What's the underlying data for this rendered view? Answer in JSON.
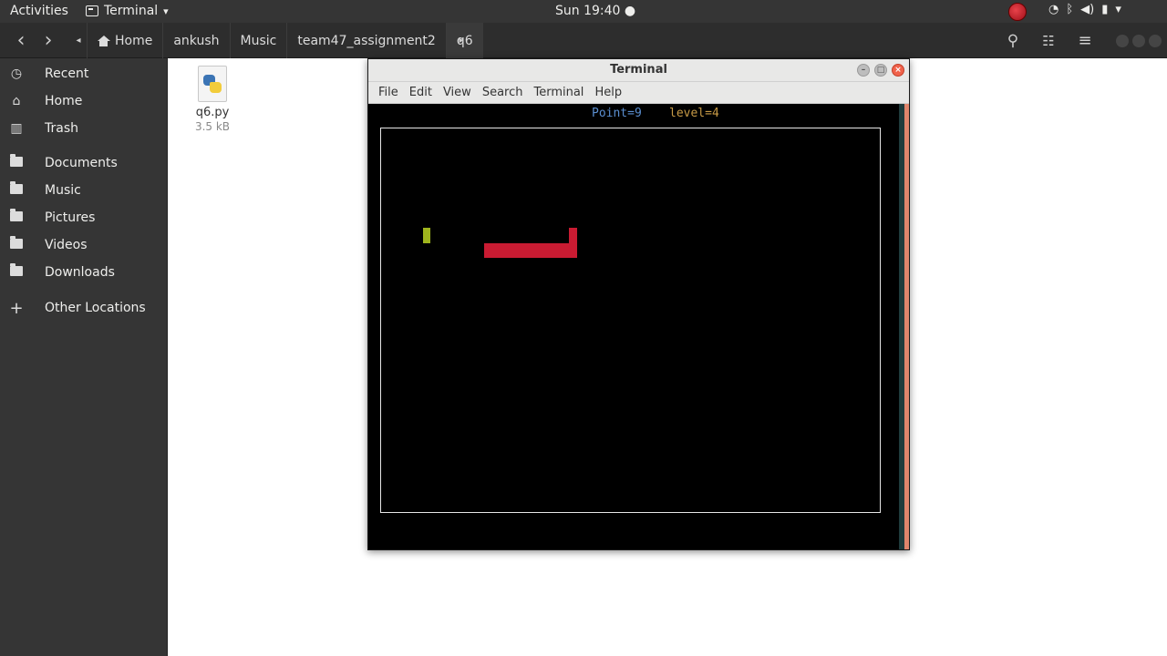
{
  "topbar": {
    "activities": "Activities",
    "app_name": "Terminal",
    "app_menu_arrow": "▾",
    "clock": "Sun 19:40 ●",
    "tray_icons": [
      "wifi-icon",
      "bluetooth-icon",
      "volume-icon",
      "battery-icon",
      "system-menu-arrow-icon"
    ]
  },
  "headerbar": {
    "back": "‹",
    "forward": "›",
    "path_left": "◂",
    "path_right": "▸",
    "breadcrumbs": [
      "Home",
      "ankush",
      "Music",
      "team47_assignment2",
      "q6"
    ],
    "search_icon": "⚲",
    "view_icon": "☷",
    "menu_icon": "≡"
  },
  "sidebar": {
    "items": [
      {
        "label": "Recent",
        "icon": "clock-icon",
        "glyph": "◷"
      },
      {
        "label": "Home",
        "icon": "home-icon",
        "glyph": "⌂"
      },
      {
        "label": "Trash",
        "icon": "trash-icon",
        "glyph": "🗑"
      },
      {
        "label": "Documents",
        "icon": "folder-icon"
      },
      {
        "label": "Music",
        "icon": "folder-icon"
      },
      {
        "label": "Pictures",
        "icon": "folder-icon"
      },
      {
        "label": "Videos",
        "icon": "folder-icon"
      },
      {
        "label": "Downloads",
        "icon": "folder-icon"
      },
      {
        "label": "Other Locations",
        "icon": "plus-icon",
        "glyph": "+"
      }
    ]
  },
  "files": [
    {
      "name": "q6.py",
      "size": "3.5 kB",
      "icon": "python-file-icon"
    }
  ],
  "terminal": {
    "title": "Terminal",
    "menu": [
      "File",
      "Edit",
      "View",
      "Search",
      "Terminal",
      "Help"
    ],
    "status_point": "Point=9",
    "status_level": "level=4"
  },
  "colors": {
    "snake": "#c91b32",
    "food": "#9fb41d",
    "point_text": "#5a8ed0",
    "level_text": "#c79a46"
  }
}
